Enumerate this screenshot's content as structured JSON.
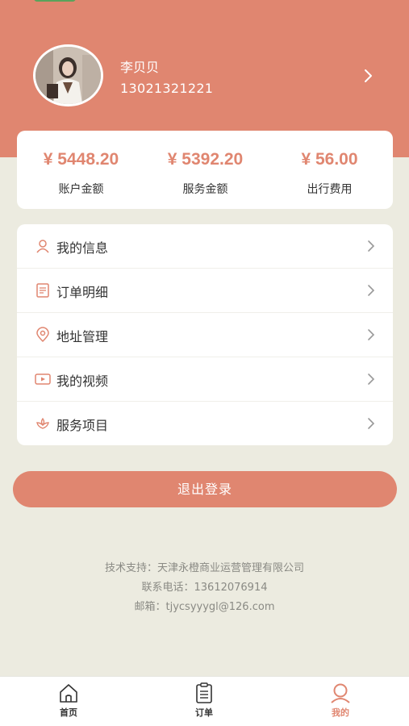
{
  "profile": {
    "name": "李贝贝",
    "phone": "13021321221"
  },
  "stats": [
    {
      "value": "¥ 5448.20",
      "label": "账户金额"
    },
    {
      "value": "¥ 5392.20",
      "label": "服务金额"
    },
    {
      "value": "¥ 56.00",
      "label": "出行费用"
    }
  ],
  "menu": [
    {
      "label": "我的信息",
      "icon": "user-icon"
    },
    {
      "label": "订单明细",
      "icon": "receipt-icon"
    },
    {
      "label": "地址管理",
      "icon": "location-pin-icon"
    },
    {
      "label": "我的视频",
      "icon": "video-icon"
    },
    {
      "label": "服务项目",
      "icon": "lotus-icon"
    }
  ],
  "logout_label": "退出登录",
  "footer": {
    "support": "技术支持：天津永橙商业运营管理有限公司",
    "phone": "联系电话：13612076914",
    "email": "邮箱：tjycsyyygl@126.com"
  },
  "tabs": [
    {
      "label": "首页",
      "icon": "home-icon"
    },
    {
      "label": "订单",
      "icon": "clipboard-icon"
    },
    {
      "label": "我的",
      "icon": "profile-icon",
      "active": true
    }
  ],
  "colors": {
    "accent": "#e08670",
    "background": "#ecebe0"
  }
}
